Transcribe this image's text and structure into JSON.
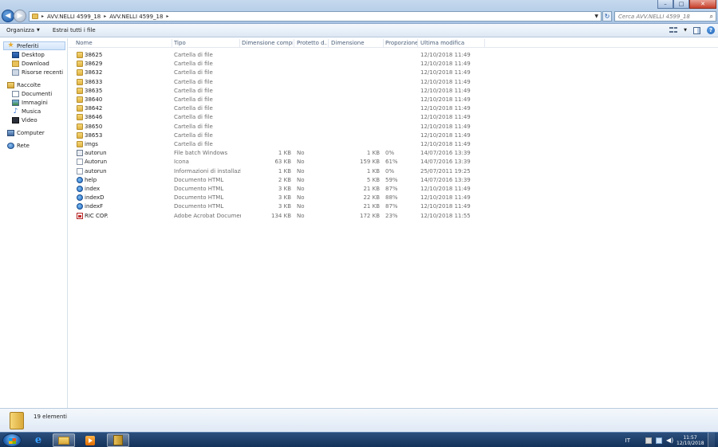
{
  "window": {
    "buttons": {
      "minimize": "–",
      "maximize": "□",
      "close": "✕"
    }
  },
  "address": {
    "crumbs": [
      "AVV.NELLI 4599_18",
      "AVV.NELLI 4599_18"
    ],
    "separator": "▸"
  },
  "search": {
    "placeholder": "Cerca AVV.NELLI 4599_18"
  },
  "toolbar": {
    "organize": "Organizza",
    "extract_all": "Estrai tutti i file"
  },
  "navigation": {
    "favorites": {
      "label": "Preferiti",
      "items": [
        "Desktop",
        "Download",
        "Risorse recenti"
      ]
    },
    "libraries": {
      "label": "Raccolte",
      "items": [
        "Documenti",
        "Immagini",
        "Musica",
        "Video"
      ]
    },
    "computer": "Computer",
    "network": "Rete"
  },
  "columns": {
    "name": "Nome",
    "type": "Tipo",
    "compressed_size": "Dimensione compr...",
    "protected": "Protetto d...",
    "size": "Dimensione",
    "ratio": "Proporzione",
    "modified": "Ultima modifica"
  },
  "files": [
    {
      "name": "38625",
      "icon": "folder-icon",
      "type": "Cartella di file",
      "compressed": "",
      "protected": "",
      "size": "",
      "ratio": "",
      "modified": "12/10/2018 11:49"
    },
    {
      "name": "38629",
      "icon": "folder-icon",
      "type": "Cartella di file",
      "compressed": "",
      "protected": "",
      "size": "",
      "ratio": "",
      "modified": "12/10/2018 11:49"
    },
    {
      "name": "38632",
      "icon": "folder-icon",
      "type": "Cartella di file",
      "compressed": "",
      "protected": "",
      "size": "",
      "ratio": "",
      "modified": "12/10/2018 11:49"
    },
    {
      "name": "38633",
      "icon": "folder-icon",
      "type": "Cartella di file",
      "compressed": "",
      "protected": "",
      "size": "",
      "ratio": "",
      "modified": "12/10/2018 11:49"
    },
    {
      "name": "38635",
      "icon": "folder-icon",
      "type": "Cartella di file",
      "compressed": "",
      "protected": "",
      "size": "",
      "ratio": "",
      "modified": "12/10/2018 11:49"
    },
    {
      "name": "38640",
      "icon": "folder-icon",
      "type": "Cartella di file",
      "compressed": "",
      "protected": "",
      "size": "",
      "ratio": "",
      "modified": "12/10/2018 11:49"
    },
    {
      "name": "38642",
      "icon": "folder-icon",
      "type": "Cartella di file",
      "compressed": "",
      "protected": "",
      "size": "",
      "ratio": "",
      "modified": "12/10/2018 11:49"
    },
    {
      "name": "38646",
      "icon": "folder-icon",
      "type": "Cartella di file",
      "compressed": "",
      "protected": "",
      "size": "",
      "ratio": "",
      "modified": "12/10/2018 11:49"
    },
    {
      "name": "38650",
      "icon": "folder-icon",
      "type": "Cartella di file",
      "compressed": "",
      "protected": "",
      "size": "",
      "ratio": "",
      "modified": "12/10/2018 11:49"
    },
    {
      "name": "38653",
      "icon": "folder-icon",
      "type": "Cartella di file",
      "compressed": "",
      "protected": "",
      "size": "",
      "ratio": "",
      "modified": "12/10/2018 11:49"
    },
    {
      "name": "imgs",
      "icon": "folder-icon",
      "type": "Cartella di file",
      "compressed": "",
      "protected": "",
      "size": "",
      "ratio": "",
      "modified": "12/10/2018 11:49"
    },
    {
      "name": "autorun",
      "icon": "batch-file-icon",
      "type": "File batch Windows",
      "compressed": "1 KB",
      "protected": "No",
      "size": "1 KB",
      "ratio": "0%",
      "modified": "14/07/2016 13:39"
    },
    {
      "name": "Autorun",
      "icon": "icon-file-icon",
      "type": "Icona",
      "compressed": "63 KB",
      "protected": "No",
      "size": "159 KB",
      "ratio": "61%",
      "modified": "14/07/2016 13:39"
    },
    {
      "name": "autorun",
      "icon": "setup-info-icon",
      "type": "Informazioni di installazio...",
      "compressed": "1 KB",
      "protected": "No",
      "size": "1 KB",
      "ratio": "0%",
      "modified": "25/07/2011 19:25"
    },
    {
      "name": "help",
      "icon": "html-document-icon",
      "type": "Documento HTML",
      "compressed": "2 KB",
      "protected": "No",
      "size": "5 KB",
      "ratio": "59%",
      "modified": "14/07/2016 13:39"
    },
    {
      "name": "index",
      "icon": "html-document-icon",
      "type": "Documento HTML",
      "compressed": "3 KB",
      "protected": "No",
      "size": "21 KB",
      "ratio": "87%",
      "modified": "12/10/2018 11:49"
    },
    {
      "name": "indexD",
      "icon": "html-document-icon",
      "type": "Documento HTML",
      "compressed": "3 KB",
      "protected": "No",
      "size": "22 KB",
      "ratio": "88%",
      "modified": "12/10/2018 11:49"
    },
    {
      "name": "indexF",
      "icon": "html-document-icon",
      "type": "Documento HTML",
      "compressed": "3 KB",
      "protected": "No",
      "size": "21 KB",
      "ratio": "87%",
      "modified": "12/10/2018 11:49"
    },
    {
      "name": "RIC COP.",
      "icon": "pdf-document-icon",
      "type": "Adobe Acrobat Document",
      "compressed": "134 KB",
      "protected": "No",
      "size": "172 KB",
      "ratio": "23%",
      "modified": "12/10/2018 11:55"
    }
  ],
  "details": {
    "count": "19 elementi"
  },
  "taskbar": {
    "language": "IT",
    "time": "11:57",
    "date": "12/10/2018"
  }
}
